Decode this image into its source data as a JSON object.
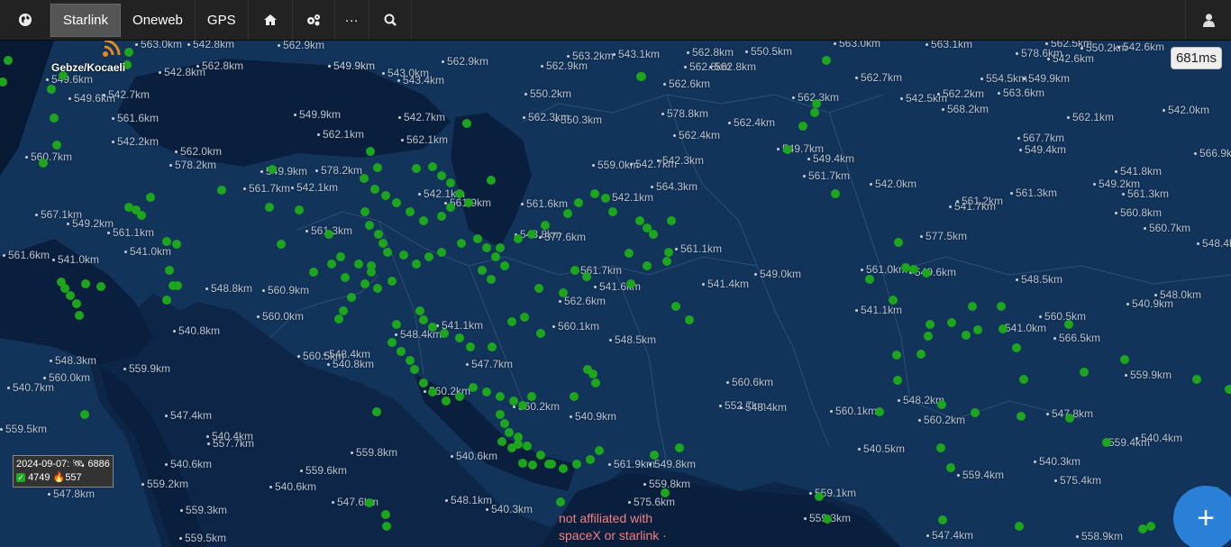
{
  "nav": {
    "globe_icon": "globe-icon",
    "tabs": [
      "Starlink",
      "Oneweb",
      "GPS"
    ],
    "home_icon": "home-icon",
    "settings_icon": "cogs-icon",
    "more_label": "···",
    "search_icon": "search-icon",
    "user_icon": "user-icon"
  },
  "map": {
    "location_label": "Gebze/Kocaeli",
    "latency": "681ms",
    "stats": {
      "date": "2024-09-07:",
      "total": "6886",
      "active": "4749",
      "fire": "557"
    },
    "disclaimer_line1": "not affiliated with",
    "disclaimer_line2": "spaceX or starlink ·",
    "fab_label": "+",
    "colors": {
      "sea": "#0d2547",
      "land": "#12345a",
      "satellite": "#1ea51e",
      "accent": "#2a7fd6"
    },
    "altitude_labels": [
      "563.0km",
      "542.8km",
      "562.9km",
      "549.9km",
      "543.0km",
      "562.9km",
      "562.9km",
      "563.2km",
      "543.1km",
      "562.8km",
      "550.5km",
      "563.0km",
      "563.1km",
      "562.5km",
      "550.2km",
      "542.6km",
      "549.6km",
      "542.8km",
      "562.8km",
      "549.9km",
      "543.4km",
      "562.8km",
      "562.8km",
      "578.6km",
      "542.6km",
      "549.6km",
      "542.7km",
      "550.2km",
      "562.6km",
      "562.7km",
      "554.5km",
      "549.9km",
      "561.6km",
      "549.9km",
      "542.7km",
      "562.3km",
      "550.3km",
      "578.8km",
      "562.4km",
      "542.5km",
      "562.2km",
      "563.6km",
      "562.1km",
      "542.0km",
      "542.2km",
      "562.1km",
      "562.1km",
      "562.3km",
      "562.4km",
      "568.2km",
      "560.7km",
      "562.0km",
      "578.2km",
      "559.0km",
      "542.7km",
      "549.7km",
      "567.7km",
      "549.4km",
      "566.9km",
      "578.2km",
      "542.3km",
      "549.4km",
      "561.7km",
      "549.9km",
      "542.1km",
      "542.1km",
      "564.3km",
      "541.8km",
      "549.2km",
      "561.3km",
      "561.7km",
      "561.9km",
      "561.6km",
      "542.1km",
      "542.0km",
      "561.2km",
      "561.3km",
      "567.1km",
      "549.2km",
      "541.7km",
      "560.8km",
      "561.1km",
      "561.3km",
      "548.8km",
      "577.6km",
      "561.1km",
      "577.5km",
      "560.7km",
      "548.4km",
      "541.0km",
      "561.6km",
      "541.0km",
      "561.7km",
      "549.0km",
      "561.0km",
      "549.6km",
      "541.6km",
      "541.4km",
      "548.5km",
      "548.0km",
      "548.8km",
      "560.9km",
      "562.6km",
      "541.1km",
      "540.9km",
      "560.0km",
      "541.1km",
      "560.1km",
      "560.5km",
      "541.0km",
      "540.8km",
      "548.4km",
      "548.5km",
      "566.5km",
      "560.5km",
      "540.8km",
      "548.4km",
      "548.3km",
      "547.7km",
      "560.6km",
      "559.9km",
      "559.9km",
      "560.0km",
      "560.2km",
      "548.2km",
      "540.7km",
      "560.2km",
      "552.7km",
      "548.4km",
      "560.1km",
      "560.2km",
      "547.8km",
      "547.4km",
      "540.9km",
      "559.5km",
      "540.4km",
      "557.7km",
      "540.5km",
      "559.4km",
      "540.4km",
      "559.8km",
      "540.6km",
      "561.9km",
      "549.8km",
      "540.3km",
      "540.6km",
      "559.6km",
      "559.8km",
      "559.4km",
      "575.4km",
      "547.8km",
      "559.2km",
      "540.6km",
      "548.1km",
      "575.6km",
      "559.1km",
      "547.6km",
      "559.3km",
      "540.3km",
      "559.3km",
      "558.9km",
      "547.4km",
      "559.5km"
    ]
  }
}
